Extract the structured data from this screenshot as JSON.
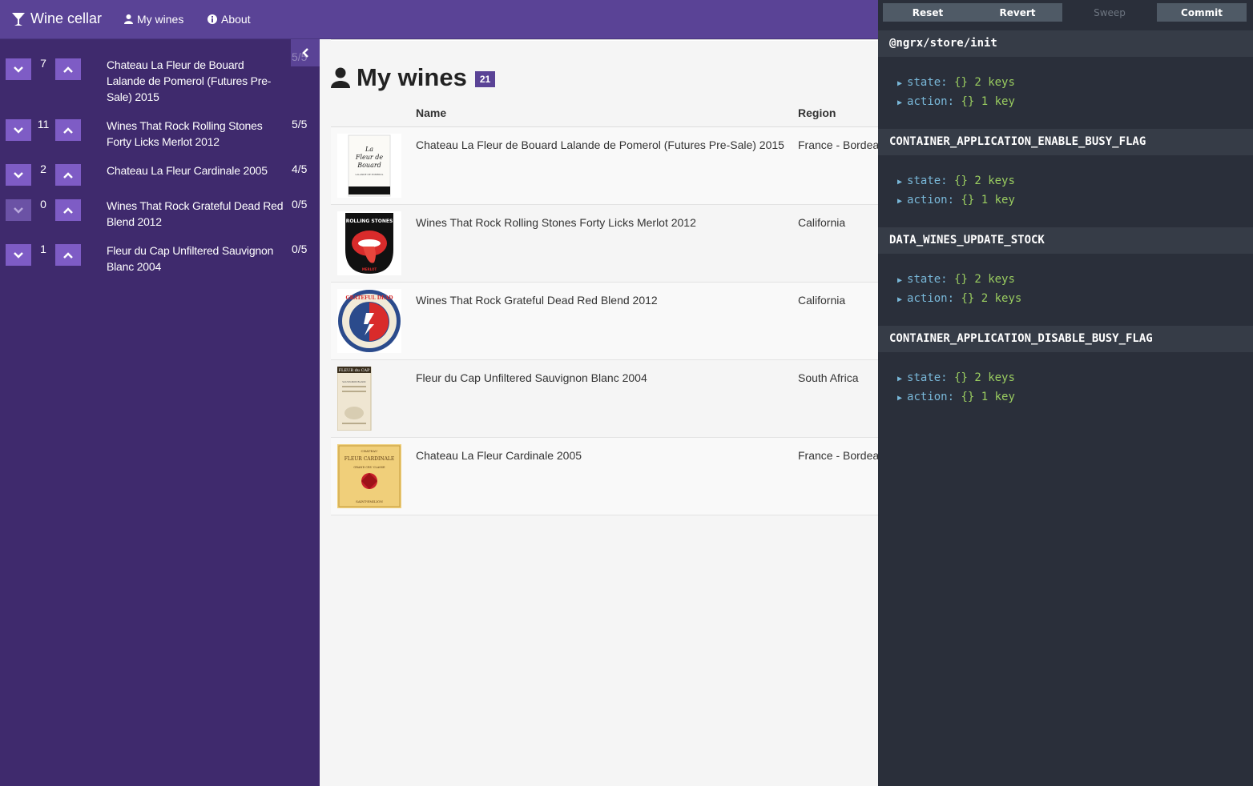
{
  "navbar": {
    "brand": "Wine cellar",
    "my_wines": "My wines",
    "about": "About"
  },
  "sidebar": {
    "items": [
      {
        "count": "7",
        "name": "Chateau La Fleur de Bouard Lalande de Pomerol (Futures Pre-Sale) 2015",
        "rating": "5/5"
      },
      {
        "count": "11",
        "name": "Wines That Rock Rolling Stones Forty Licks Merlot 2012",
        "rating": "5/5"
      },
      {
        "count": "2",
        "name": "Chateau La Fleur Cardinale 2005",
        "rating": "4/5"
      },
      {
        "count": "0",
        "name": "Wines That Rock Grateful Dead Red Blend 2012",
        "rating": "0/5"
      },
      {
        "count": "1",
        "name": "Fleur du Cap Unfiltered Sauvignon Blanc 2004",
        "rating": "0/5"
      }
    ]
  },
  "main": {
    "title": "My wines",
    "count": "21",
    "columns": {
      "name": "Name",
      "region": "Region"
    },
    "wines": [
      {
        "name": "Chateau La Fleur de Bouard Lalande de Pomerol (Futures Pre-Sale) 2015",
        "region": "France - Bordeaux",
        "label_text": [
          "La",
          "Fleur de",
          "Bouard",
          "LALANDE DE POMEROL"
        ]
      },
      {
        "name": "Wines That Rock Rolling Stones Forty Licks Merlot 2012",
        "region": "California",
        "label_text": [
          "ROLLING STONES",
          "MERLOT"
        ]
      },
      {
        "name": "Wines That Rock Grateful Dead Red Blend 2012",
        "region": "California",
        "label_text": [
          "GRATEFUL DEAD"
        ]
      },
      {
        "name": "Fleur du Cap Unfiltered Sauvignon Blanc 2004",
        "region": "South Africa",
        "label_text": [
          "FLEUR du CAP",
          "SAUVIGNON BLANC"
        ]
      },
      {
        "name": "Chateau La Fleur Cardinale 2005",
        "region": "France - Bordeaux",
        "label_text": [
          "CHATEAU",
          "FLEUR CARDINALE",
          "GRAND CRU CLASSE",
          "SAINT-EMILION"
        ]
      }
    ]
  },
  "devtools": {
    "buttons": {
      "reset": "Reset",
      "revert": "Revert",
      "sweep": "Sweep",
      "commit": "Commit"
    },
    "actions": [
      {
        "type": "@ngrx/store/init",
        "state_key": "state:",
        "state_val": "{} 2 keys",
        "action_key": "action:",
        "action_val": "{} 1 key"
      },
      {
        "type": "CONTAINER_APPLICATION_ENABLE_BUSY_FLAG",
        "state_key": "state:",
        "state_val": "{} 2 keys",
        "action_key": "action:",
        "action_val": "{} 1 key"
      },
      {
        "type": "DATA_WINES_UPDATE_STOCK",
        "state_key": "state:",
        "state_val": "{} 2 keys",
        "action_key": "action:",
        "action_val": "{} 2 keys"
      },
      {
        "type": "CONTAINER_APPLICATION_DISABLE_BUSY_FLAG",
        "state_key": "state:",
        "state_val": "{} 2 keys",
        "action_key": "action:",
        "action_val": "{} 1 key"
      }
    ]
  },
  "colors": {
    "navbar": "#5a4396",
    "sidebar": "#3f2a6d",
    "stepper": "#7e5cc5",
    "devtools_bg": "#2a2f3a",
    "devtools_key": "#79b8d9",
    "devtools_value": "#9acd60"
  }
}
